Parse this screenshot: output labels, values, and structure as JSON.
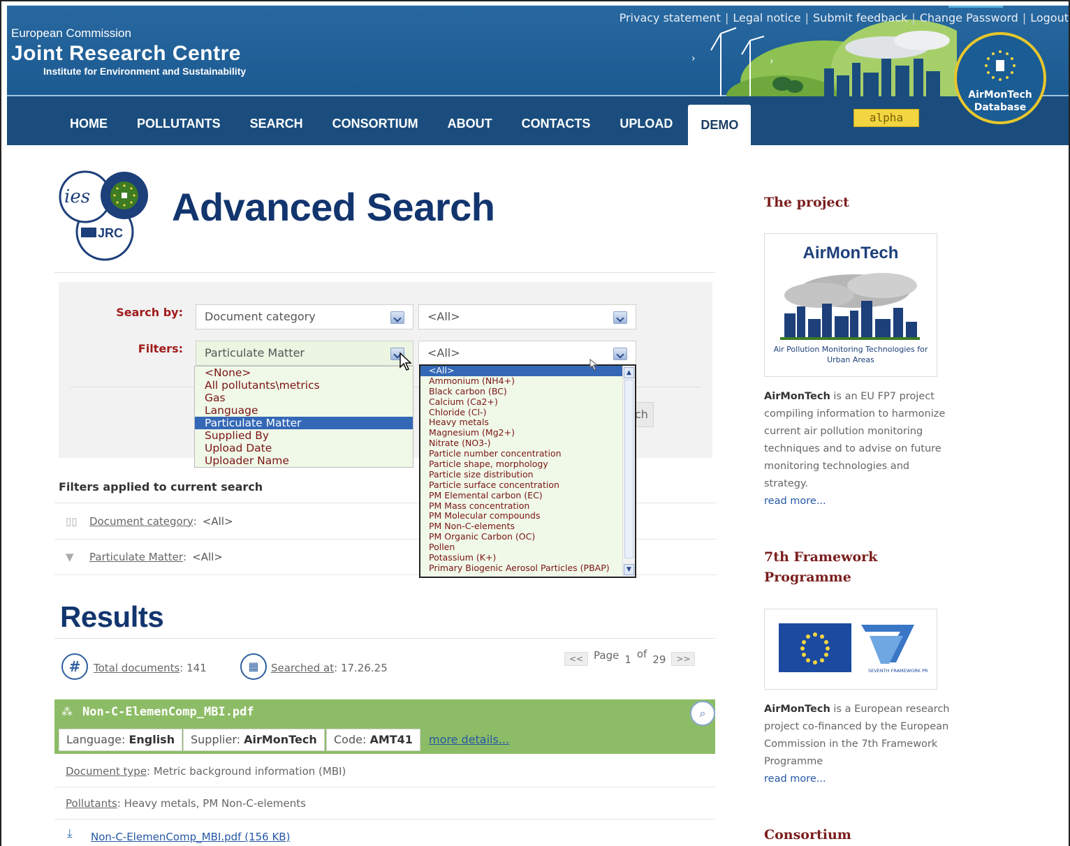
{
  "header": {
    "org": "European Commission",
    "centre": "Joint Research Centre",
    "institute": "Institute for Environment and Sustainability",
    "top_links": [
      "Privacy statement",
      "Legal notice",
      "Submit feedback",
      "Change Password",
      "Logout"
    ],
    "logo_line1": "AirMonTech",
    "logo_line2": "Database",
    "badge": "alpha"
  },
  "nav": {
    "items": [
      "HOME",
      "POLLUTANTS",
      "SEARCH",
      "CONSORTIUM",
      "ABOUT",
      "CONTACTS",
      "UPLOAD",
      "DEMO"
    ],
    "active": "DEMO"
  },
  "page": {
    "title": "Advanced Search",
    "logo_text_ies": "ies",
    "logo_text_jrc": "JRC"
  },
  "form": {
    "search_by_label": "Search by:",
    "filters_label": "Filters:",
    "search_by_value": "Document category",
    "search_by_sub_value": "<All>",
    "filters_value": "Particulate Matter",
    "filters_sub_value": "<All>",
    "search_button_peek": "ch",
    "filters_options": [
      "<None>",
      "All pollutants\\metrics",
      "Gas",
      "Language",
      "Particulate Matter",
      "Supplied By",
      "Upload Date",
      "Uploader Name"
    ],
    "filters_selected": "Particulate Matter",
    "sub_options": [
      "<All>",
      "Ammonium (NH4+)",
      "Black carbon (BC)",
      "Calcium (Ca2+)",
      "Chloride (Cl-)",
      "Heavy metals",
      "Magnesium (Mg2+)",
      "Nitrate (NO3-)",
      "Particle number concentration",
      "Particle shape, morphology",
      "Particle size distribution",
      "Particle surface concentration",
      "PM Elemental carbon (EC)",
      "PM Mass concentration",
      "PM Molecular compounds",
      "PM Non-C-elements",
      "PM Organic Carbon (OC)",
      "Pollen",
      "Potassium (K+)",
      "Primary Biogenic Aerosol Particles (PBAP)"
    ],
    "sub_selected": "<All>"
  },
  "filters_applied": {
    "title": "Filters applied to current search",
    "rows": [
      {
        "label": "Document category",
        "sep": ":",
        "value": "<All>"
      },
      {
        "label": "Particulate Matter",
        "sep": ":",
        "value": "<All>"
      }
    ]
  },
  "results": {
    "title": "Results",
    "total_label": "Total documents",
    "total_value": ": 141",
    "searched_label": "Searched at",
    "searched_value": ": 17.26.25",
    "pager": {
      "prev": "<<",
      "page_word": "Page",
      "current": "1",
      "of_word": "of",
      "total": "29",
      "next": ">>"
    },
    "doc": {
      "name": "Non-C-ElemenComp_MBI.pdf",
      "tags": [
        {
          "k": "Language: ",
          "v": "English"
        },
        {
          "k": "Supplier: ",
          "v": "AirMonTech"
        },
        {
          "k": "Code: ",
          "v": "AMT41"
        }
      ],
      "more_details": "more details...",
      "doctype_label": "Document type",
      "doctype_value": ": Metric background information (MBI)",
      "pollutants_label": "Pollutants",
      "pollutants_value": ": Heavy metals, PM Non-C-elements",
      "file_link": "Non-C-ElemenComp_MBI.pdf (156 KB)"
    }
  },
  "sidebar": {
    "project_title": "The project",
    "project_logo_title": "AirMonTech",
    "project_logo_sub": "Air Pollution Monitoring Technologies for Urban Areas",
    "project_brand": "AirMonTech",
    "project_text": " is an EU FP7 project compiling information to harmonize current air pollution monitoring techniques and to advise on future monitoring technologies and strategy.",
    "read_more": "read more...",
    "fp7_title": "7th Framework Programme",
    "fp7_logo_text": "SEVENTH FRAMEWORK PROGRAMME",
    "fp7_brand": "AirMonTech",
    "fp7_text": " is a European research project co-financed by the European Commission in the 7th Framework Programme",
    "read_more2": "read more...",
    "consortium_title": "Consortium"
  },
  "colors": {
    "header_blue": "#1d5a8e",
    "nav_blue": "#1a4d7d",
    "title_navy": "#12356e",
    "accent_red": "#a01c1c",
    "doc_green": "#8dbc66",
    "select_blue": "#3468b6",
    "badge_yellow": "#f3d542"
  }
}
